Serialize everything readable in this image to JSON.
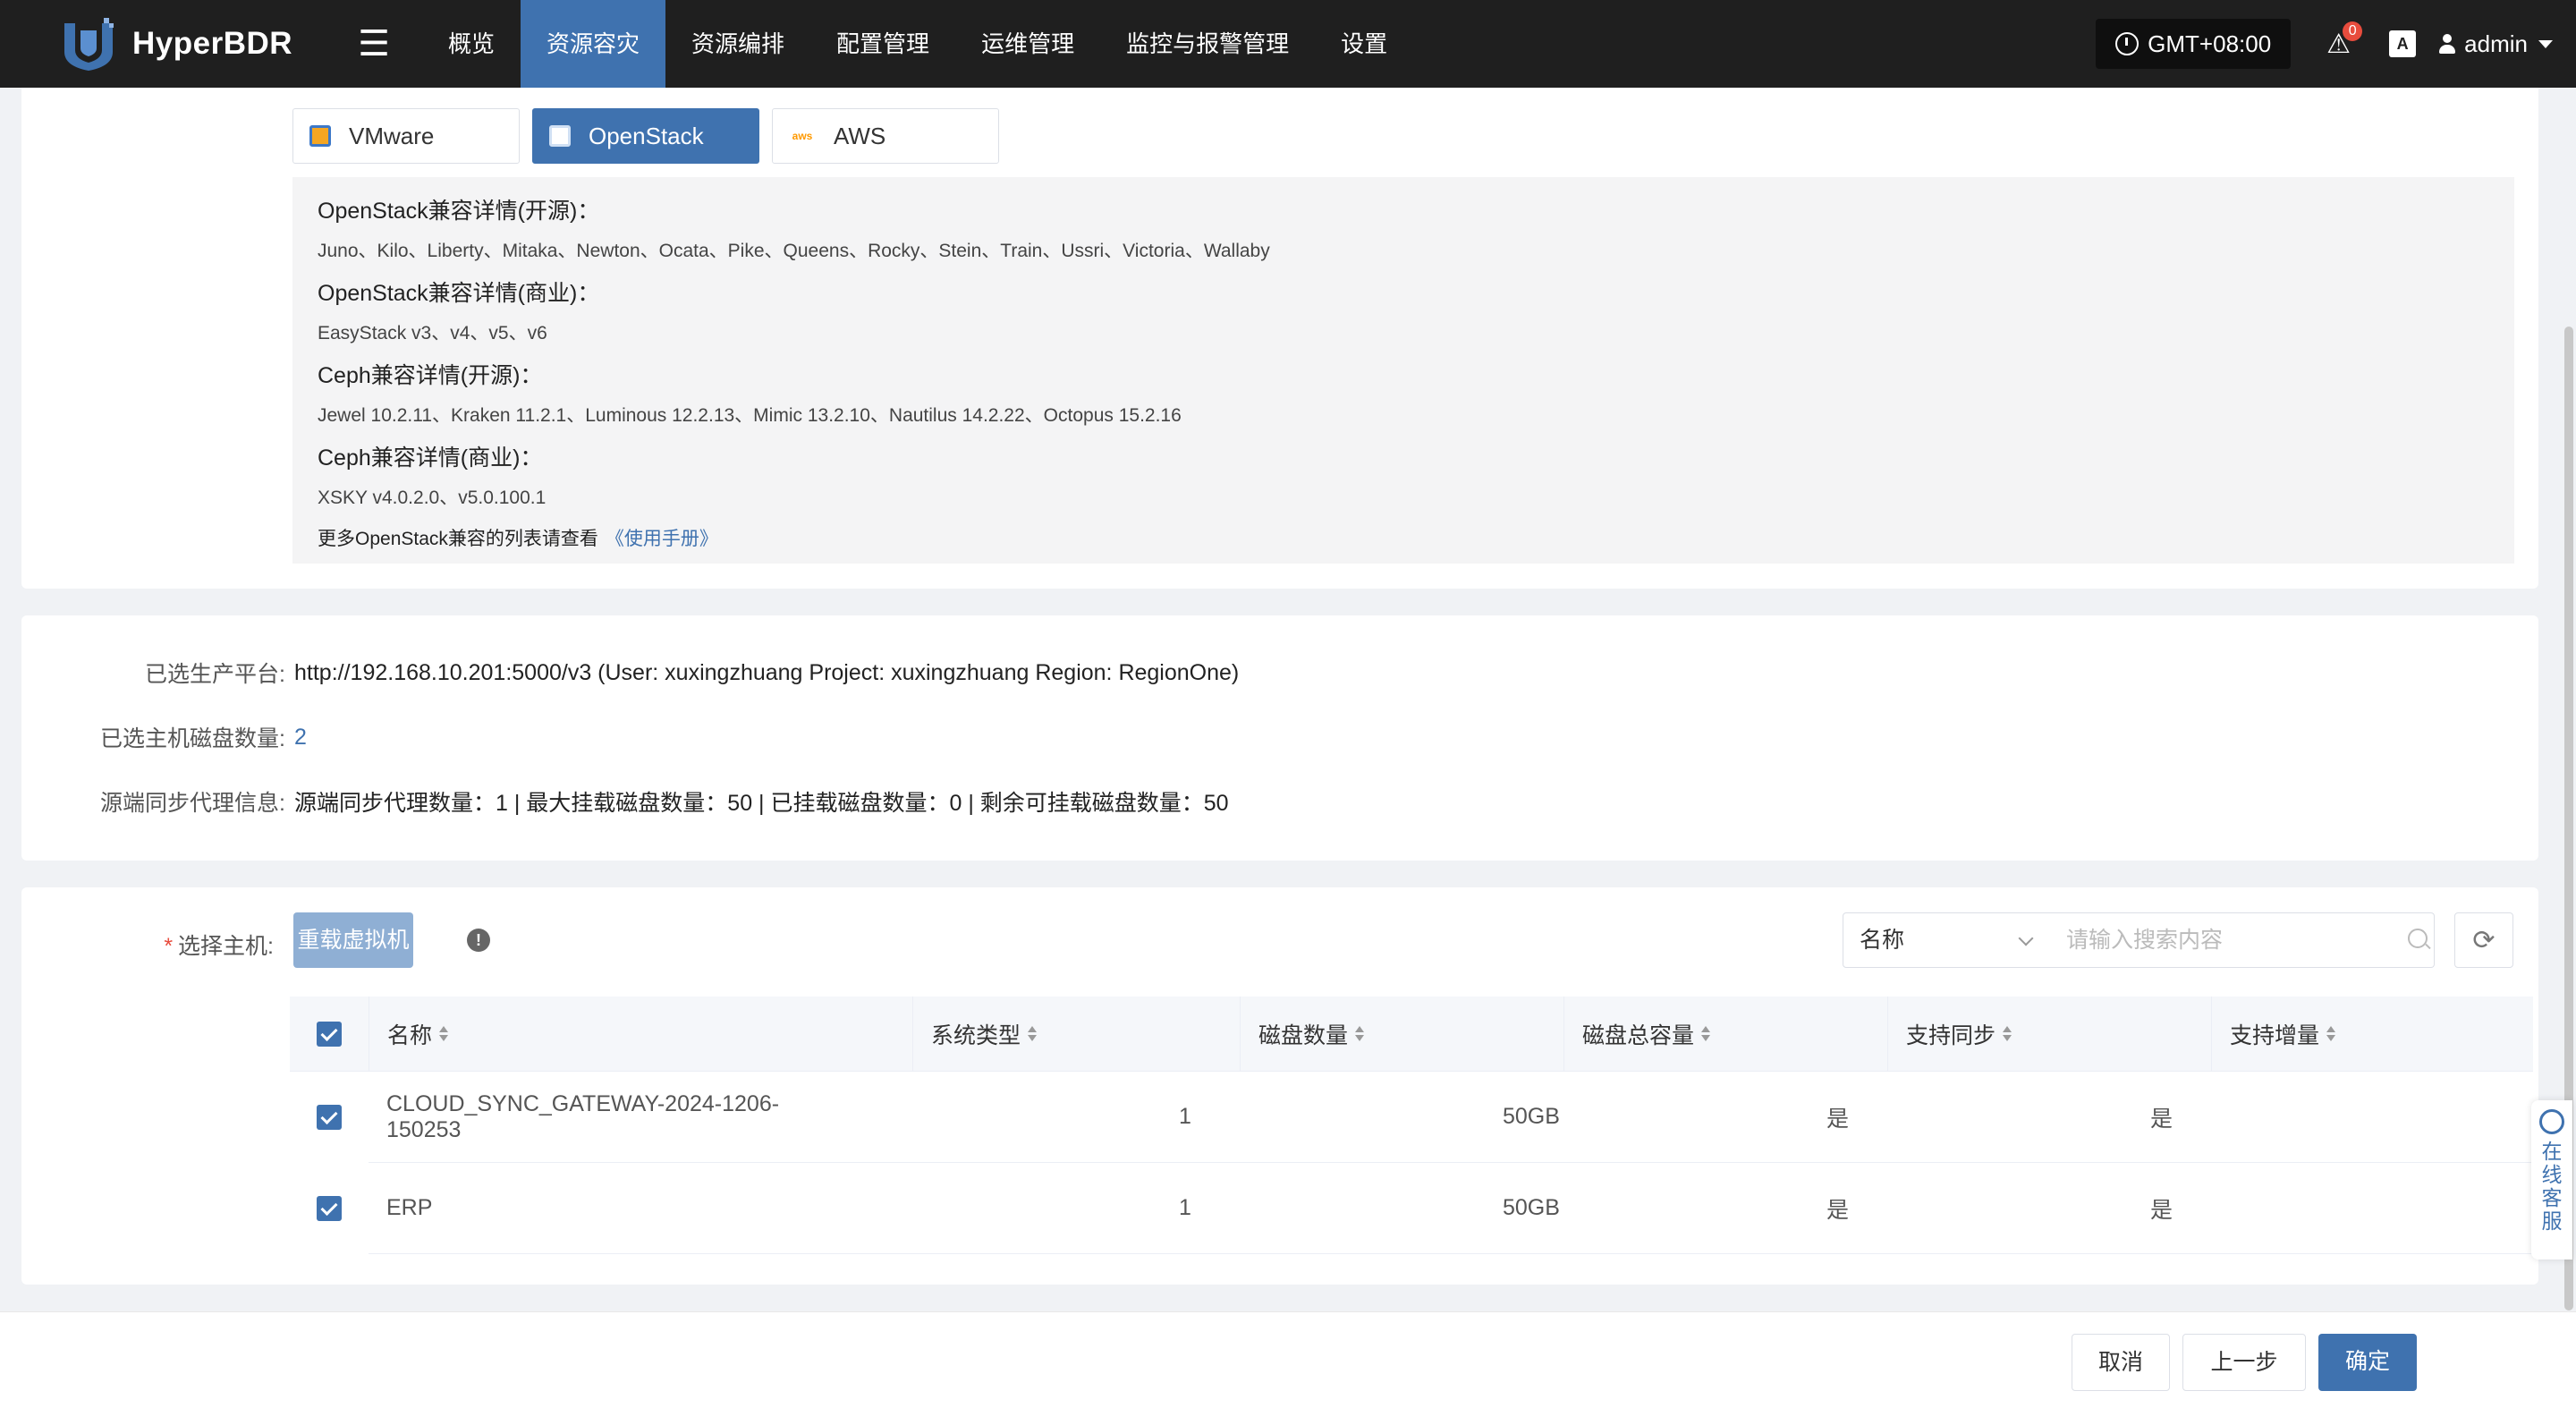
{
  "app": {
    "name": "HyperBDR"
  },
  "nav": {
    "items": [
      {
        "label": "概览"
      },
      {
        "label": "资源容灾"
      },
      {
        "label": "资源编排"
      },
      {
        "label": "配置管理"
      },
      {
        "label": "运维管理"
      },
      {
        "label": "监控与报警管理"
      },
      {
        "label": "设置"
      }
    ],
    "active_index": 1
  },
  "header": {
    "timezone": "GMT+08:00",
    "alert_count": "0",
    "lang_icon_text": "A",
    "user": "admin"
  },
  "platform_tabs": [
    {
      "label": "VMware",
      "icon": "vmware-icon"
    },
    {
      "label": "OpenStack",
      "icon": "openstack-icon",
      "active": true
    },
    {
      "label": "AWS",
      "icon": "aws-icon"
    }
  ],
  "compat": {
    "sections": [
      {
        "title": "OpenStack兼容详情(开源)：",
        "text": "Juno、Kilo、Liberty、Mitaka、Newton、Ocata、Pike、Queens、Rocky、Stein、Train、Ussri、Victoria、Wallaby"
      },
      {
        "title": "OpenStack兼容详情(商业)：",
        "text": "EasyStack v3、v4、v5、v6"
      },
      {
        "title": "Ceph兼容详情(开源)：",
        "text": "Jewel 10.2.11、Kraken 11.2.1、Luminous 12.2.13、Mimic 13.2.10、Nautilus 14.2.22、Octopus 15.2.16"
      },
      {
        "title": "Ceph兼容详情(商业)：",
        "text": "XSKY v4.0.2.0、v5.0.100.1"
      }
    ],
    "footer_text": "更多OpenStack兼容的列表请查看",
    "footer_link": "《使用手册》"
  },
  "selection_info": {
    "platform_label": "已选生产平台:",
    "platform_value": "http://192.168.10.201:5000/v3 (User: xuxingzhuang Project: xuxingzhuang Region: RegionOne)",
    "disk_count_label": "已选主机磁盘数量:",
    "disk_count_value": "2",
    "agent_label": "源端同步代理信息:",
    "agent_value": "源端同步代理数量：1 | 最大挂载磁盘数量：50 | 已挂载磁盘数量：0 | 剩余可挂载磁盘数量：50"
  },
  "host_select": {
    "label": "选择主机:",
    "required_mark": "*",
    "reload_label": "重载虚拟机",
    "search_field": "名称",
    "search_placeholder": "请输入搜索内容"
  },
  "table": {
    "columns": [
      "名称",
      "系统类型",
      "磁盘数量",
      "磁盘总容量",
      "支持同步",
      "支持增量"
    ],
    "rows": [
      {
        "name": "CLOUD_SYNC_GATEWAY-2024-1206-150253",
        "os": "",
        "disks": "1",
        "capacity": "50GB",
        "sync": "是",
        "incremental": "是",
        "checked": true
      },
      {
        "name": "ERP",
        "os": "",
        "disks": "1",
        "capacity": "50GB",
        "sync": "是",
        "incremental": "是",
        "checked": true
      }
    ]
  },
  "footer": {
    "cancel": "取消",
    "prev": "上一步",
    "ok": "确定"
  },
  "online_service": {
    "label": "在线客服"
  },
  "colors": {
    "accent": "#3f72af",
    "topbar": "#1f1f1f",
    "danger": "#e84c3d"
  }
}
